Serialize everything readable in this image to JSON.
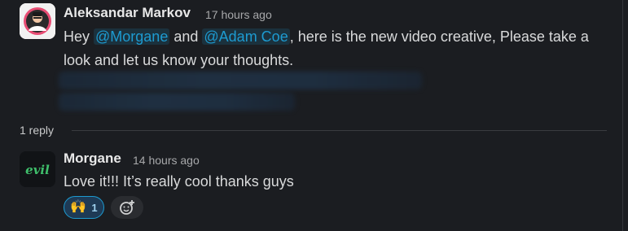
{
  "parent": {
    "author": "Aleksandar Markov",
    "time": "17 hours ago",
    "text_parts": [
      "Hey ",
      "@Morgane",
      " and ",
      "@Adam Coe",
      ", here is the new video creative, Please take a"
    ],
    "text_line2": "look and let us know your thoughts."
  },
  "thread_meta": {
    "reply_count": "1 reply"
  },
  "reply": {
    "author": "Morgane",
    "time": "14 hours ago",
    "text": "Love it!!! It’s really cool thanks guys",
    "avatar_text": "evil",
    "reaction": {
      "emoji": "🙌",
      "count": "1"
    }
  },
  "colors": {
    "background": "#1b1d21",
    "mention": "#1d9bd1",
    "reaction_bg": "#1e3a55",
    "reaction_border": "#1d9bd1",
    "divider": "#3a3c40"
  },
  "icons": {
    "avatar_1": "person-avatar-icon",
    "add_reaction": "emoji-add-icon"
  }
}
